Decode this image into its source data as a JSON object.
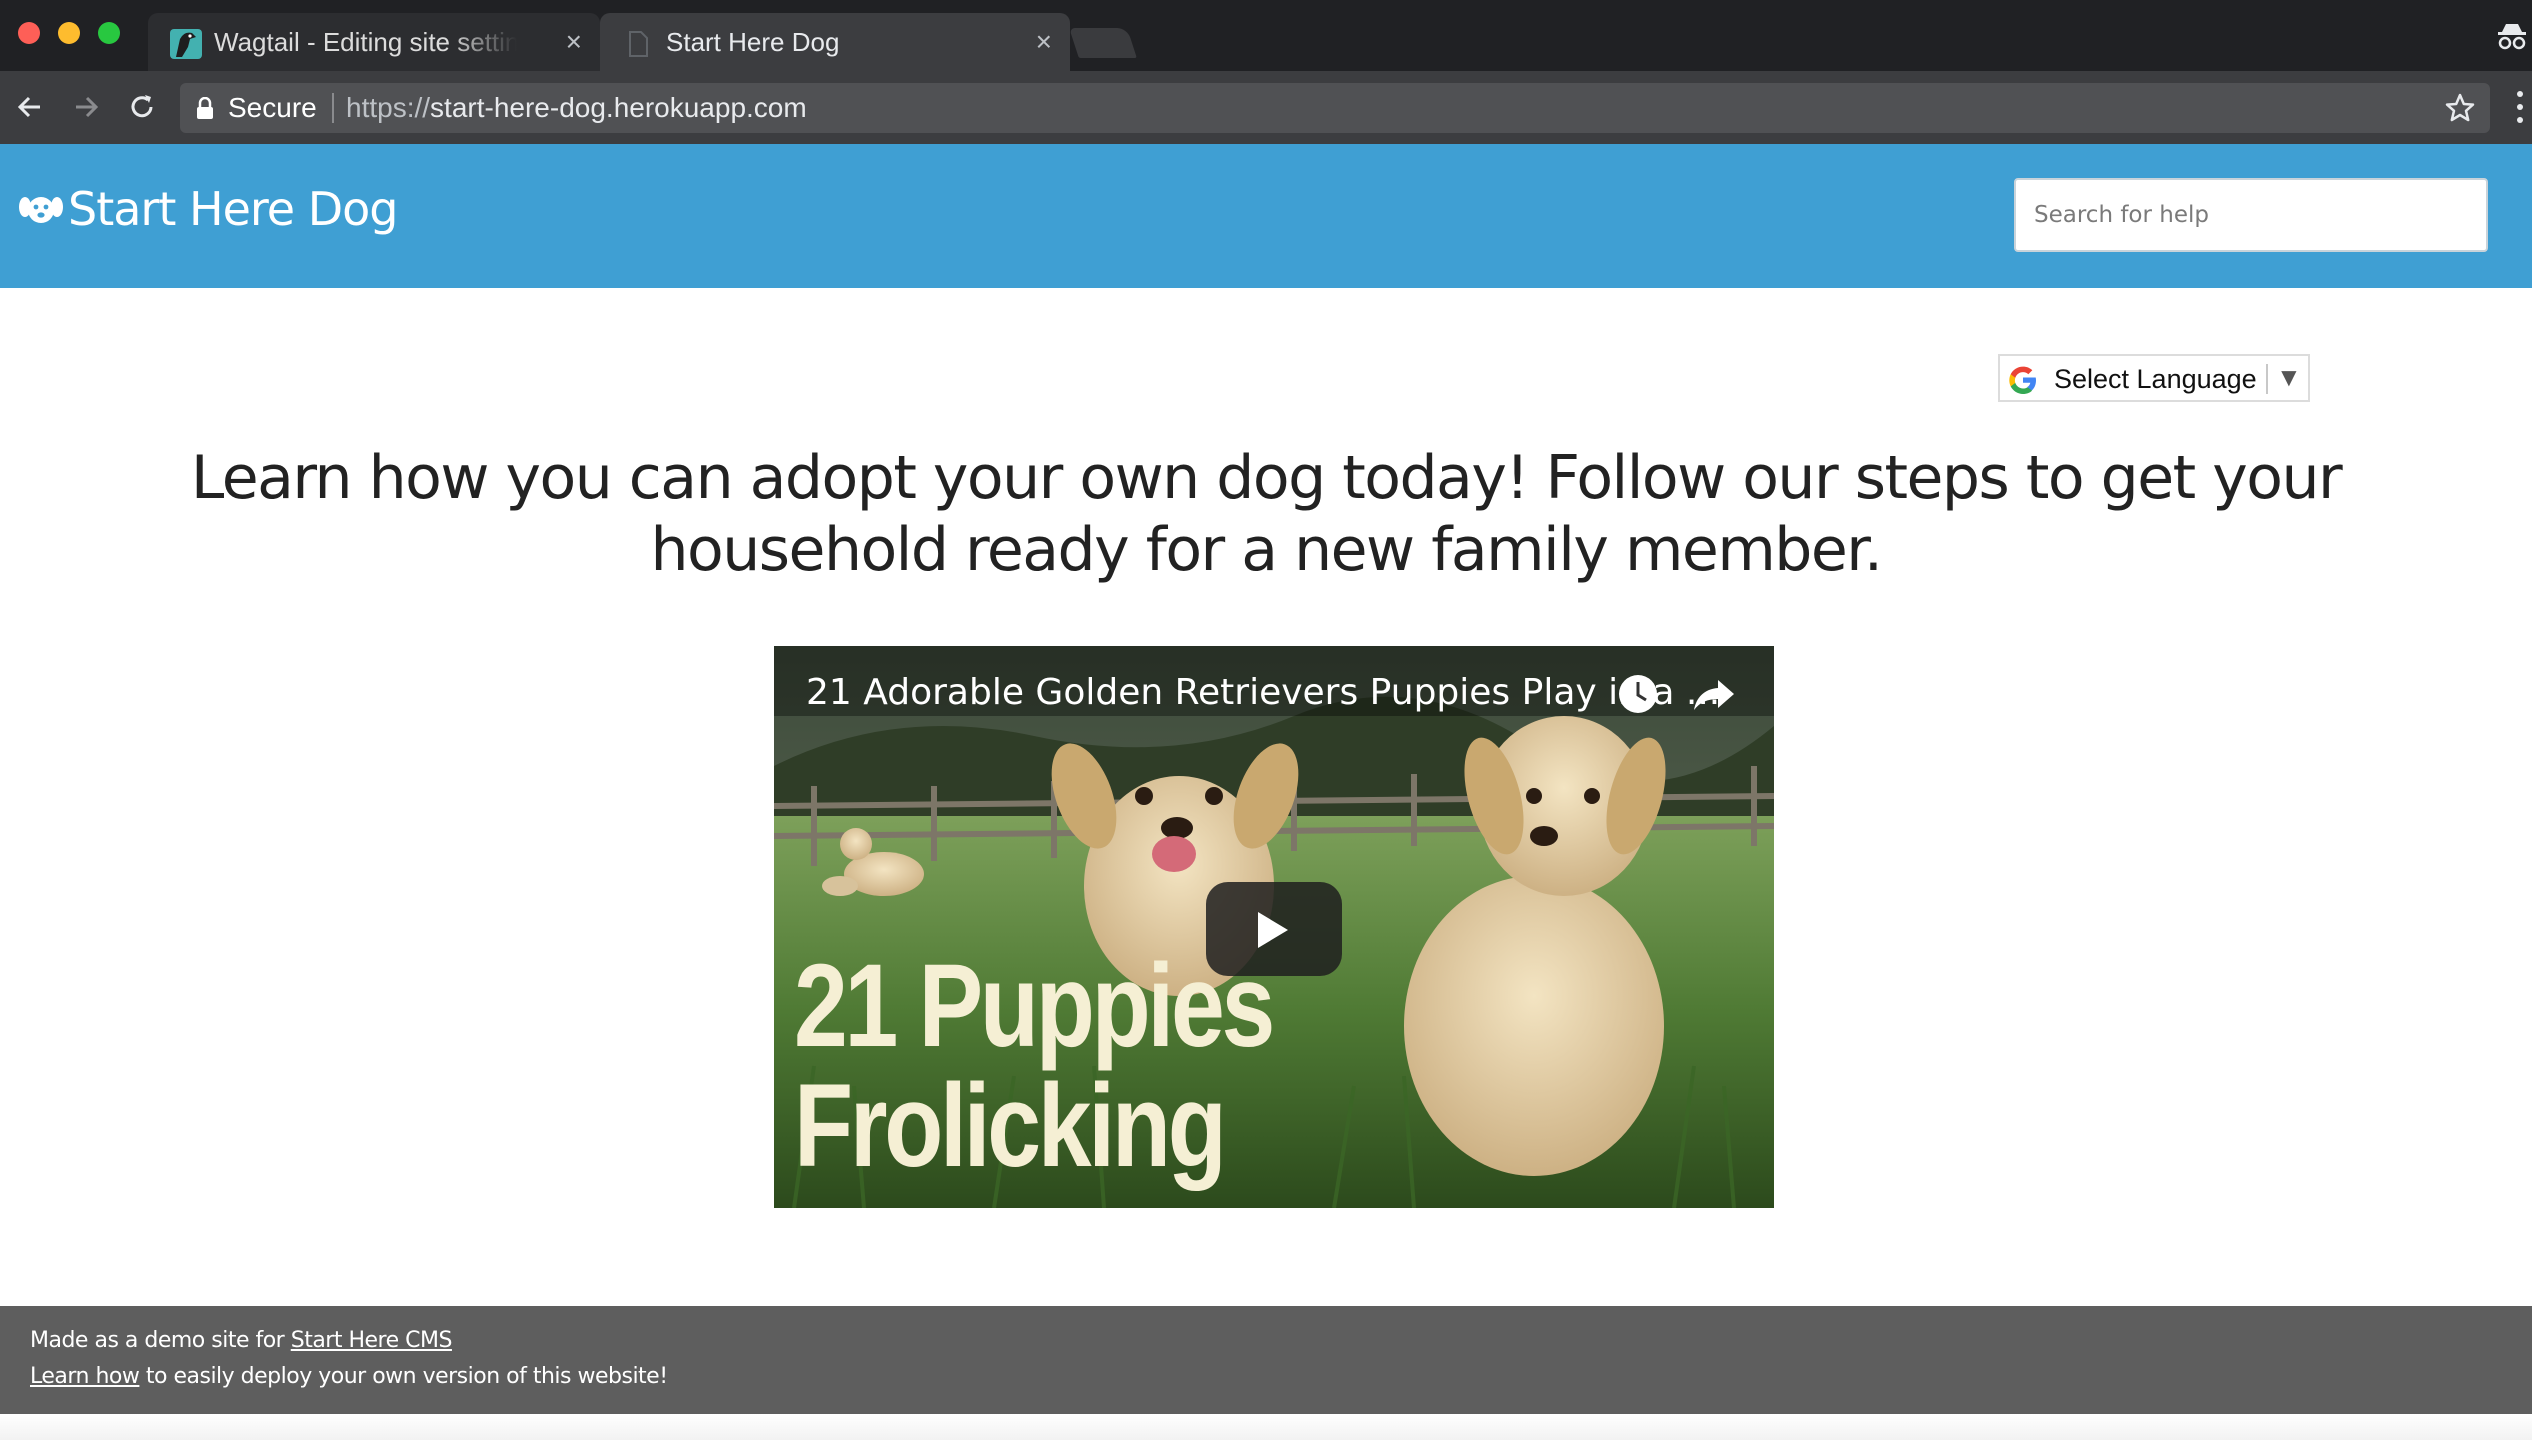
{
  "browser": {
    "tabs": [
      {
        "title": "Wagtail - Editing site settings",
        "active": false
      },
      {
        "title": "Start Here Dog",
        "active": true
      }
    ],
    "close_glyph": "×",
    "address_bar": {
      "security_label": "Secure",
      "url_scheme": "https://",
      "url_host": "start-here-dog.herokuapp.com"
    },
    "icons": [
      "back-arrow-icon",
      "forward-arrow-icon",
      "reload-icon",
      "lock-icon",
      "star-icon",
      "menu-icon",
      "incognito-icon"
    ]
  },
  "header": {
    "brand_name": "Start Here Dog",
    "search_placeholder": "Search for help",
    "background_color": "#3f9fd3"
  },
  "language_selector": {
    "label": "Select Language",
    "arrow": "▼"
  },
  "main": {
    "headline": "Learn how you can adopt your own dog today! Follow our steps to get your household ready for a new family member."
  },
  "video": {
    "title": "21 Adorable Golden Retrievers Puppies Play in a ...",
    "overlay_line1": "21 Puppies",
    "overlay_line2": "Frolicking"
  },
  "footer": {
    "line1_prefix": "Made as a demo site for ",
    "line1_link": "Start Here CMS",
    "line2_link": "Learn how",
    "line2_suffix": " to easily deploy your own version of this website!",
    "background_color": "#5e5e5e"
  }
}
